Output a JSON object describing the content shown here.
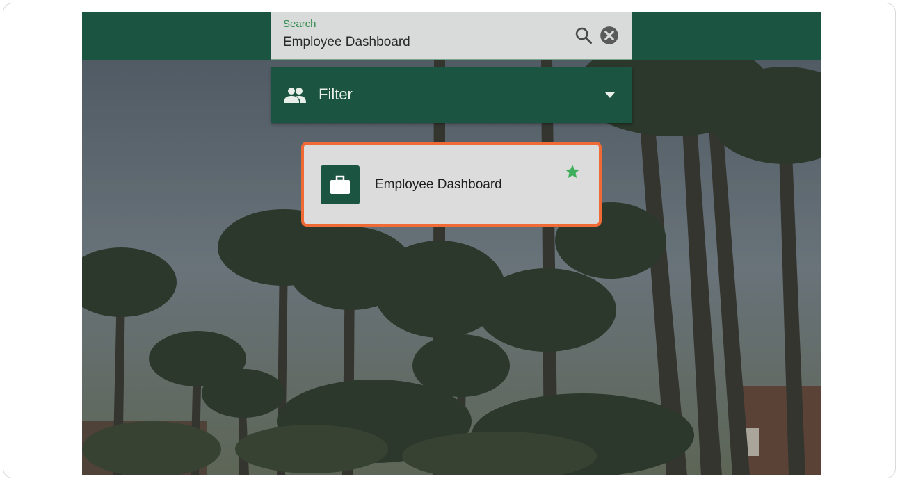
{
  "search": {
    "label": "Search",
    "value": "Employee Dashboard"
  },
  "filter": {
    "label": "Filter"
  },
  "results": [
    {
      "title": "Employee Dashboard",
      "favorited": true
    }
  ],
  "colors": {
    "brand_green": "#1b5440",
    "highlight_orange": "#f06a35",
    "star_green": "#3fae5a"
  }
}
